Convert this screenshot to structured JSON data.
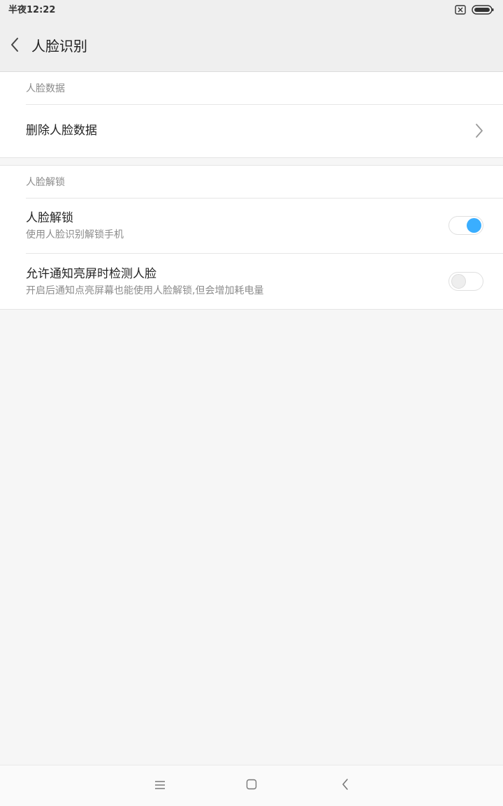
{
  "status_bar": {
    "time": "半夜12:22",
    "icons": [
      "sim-off-icon",
      "battery-icon"
    ]
  },
  "header": {
    "title": "人脸识别",
    "back_icon": "chevron-left-icon"
  },
  "sections": [
    {
      "header": "人脸数据",
      "rows": [
        {
          "title": "删除人脸数据",
          "control": "chevron-right-icon"
        }
      ]
    },
    {
      "header": "人脸解锁",
      "rows": [
        {
          "title": "人脸解锁",
          "subtitle": "使用人脸识别解锁手机",
          "toggle": "on"
        },
        {
          "title": "允许通知亮屏时检测人脸",
          "subtitle": "开启后通知点亮屏幕也能使用人脸解锁,但会增加耗电量",
          "toggle": "off"
        }
      ]
    }
  ],
  "nav_bar": {
    "icons": [
      "menu-icon",
      "home-icon",
      "back-icon"
    ]
  },
  "colors": {
    "accent": "#3aaeff",
    "background": "#f6f6f6",
    "bar": "#efefef"
  }
}
